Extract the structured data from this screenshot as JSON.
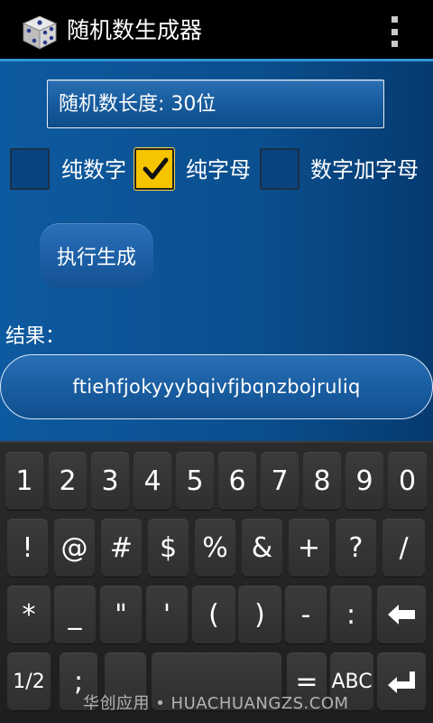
{
  "titlebar": {
    "title": "随机数生成器",
    "app_icon": "dice-icon",
    "menu_icon": "overflow-menu-icon"
  },
  "settings": {
    "length_label": "随机数长度:   30位"
  },
  "options": [
    {
      "label": "纯数字",
      "checked": false
    },
    {
      "label": "纯字母",
      "checked": true
    },
    {
      "label": "数字加字母",
      "checked": false
    }
  ],
  "actions": {
    "generate_label": "执行生成"
  },
  "result": {
    "label": "结果：",
    "value": "ftiehfjokyyybqivfjbqnzbojruliq"
  },
  "keyboard": {
    "row1": [
      "1",
      "2",
      "3",
      "4",
      "5",
      "6",
      "7",
      "8",
      "9",
      "0"
    ],
    "row2": [
      "!",
      "@",
      "#",
      "$",
      "%",
      "&",
      "+",
      "?",
      "/"
    ],
    "row3": [
      "*",
      "_",
      "\"",
      "'",
      "(",
      ")",
      "-",
      ":"
    ],
    "row4": [
      "1/2",
      ";",
      "",
      "",
      "=",
      "ABC"
    ],
    "backspace_icon": "backspace-arrow-icon",
    "enter_icon": "enter-icon"
  },
  "watermark": "华创应用 • HUACHUANGZS.COM",
  "colors": {
    "accent": "#2f97d6",
    "checkbox_checked": "#f7c400",
    "background": "#0b4f8c"
  }
}
